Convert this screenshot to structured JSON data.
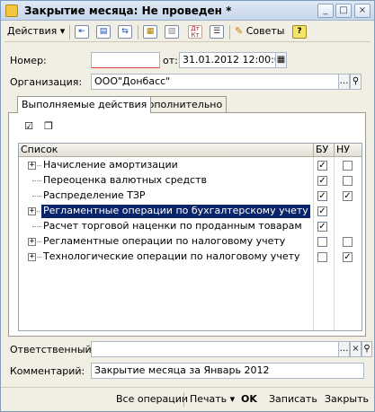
{
  "window": {
    "title": "Закрытие месяца: Не проведен *",
    "controls": [
      "_",
      "□",
      "×"
    ]
  },
  "toolbar": {
    "actions_label": "Действия",
    "actions_arrow": "▾",
    "icons": [
      "arrow-left-icon",
      "document-icon",
      "refresh-icon",
      "post-icon",
      "copy-icon",
      "dt-kt-icon",
      "report-icon",
      "hints-icon"
    ],
    "dt_kt_label": "Дт\nКт",
    "tips_label": "Советы",
    "help_label": "?"
  },
  "form": {
    "number_label": "Номер:",
    "number_value": "",
    "from_label": "от:",
    "date_value": "31.01.2012 12:00:00",
    "organization_label": "Организация:",
    "organization_value": "ООО\"Донбасс\"",
    "responsible_label": "Ответственный:",
    "responsible_value": "",
    "comment_label": "Комментарий:",
    "comment_value": "Закрытие месяца за Январь 2012"
  },
  "tabs": [
    {
      "label": "Выполняемые действия",
      "active": true
    },
    {
      "label": "Дополнительно",
      "active": false
    }
  ],
  "table": {
    "columns": [
      "Список",
      "БУ",
      "НУ"
    ],
    "rows": [
      {
        "label": "Начисление амортизации",
        "expandable": true,
        "bu": true,
        "nu": false,
        "nu_visible": true,
        "selected": false
      },
      {
        "label": "Переоценка валютных средств",
        "expandable": false,
        "bu": true,
        "nu": false,
        "nu_visible": true,
        "selected": false
      },
      {
        "label": "Распределение ТЗР",
        "expandable": false,
        "bu": true,
        "nu": true,
        "nu_visible": true,
        "selected": false
      },
      {
        "label": "Регламентные операции по бухгалтерскому учету",
        "expandable": true,
        "bu": true,
        "nu": false,
        "nu_visible": false,
        "selected": true
      },
      {
        "label": "Расчет торговой наценки по проданным товарам",
        "expandable": false,
        "bu": true,
        "nu": false,
        "nu_visible": false,
        "selected": false
      },
      {
        "label": "Регламентные операции по налоговому учету",
        "expandable": true,
        "bu": false,
        "nu": false,
        "nu_visible": true,
        "selected": false
      },
      {
        "label": "Технологические операции по налоговому учету",
        "expandable": true,
        "bu": false,
        "nu": true,
        "nu_visible": true,
        "selected": false
      }
    ]
  },
  "bottom": {
    "all_operations": "Все операции",
    "print": "Печать",
    "print_arrow": "▾",
    "ok": "OK",
    "save": "Записать",
    "close": "Закрыть"
  },
  "colors": {
    "selection": "#0a246a",
    "window_bg": "#f1eee4",
    "required_underline": "#e04040"
  }
}
